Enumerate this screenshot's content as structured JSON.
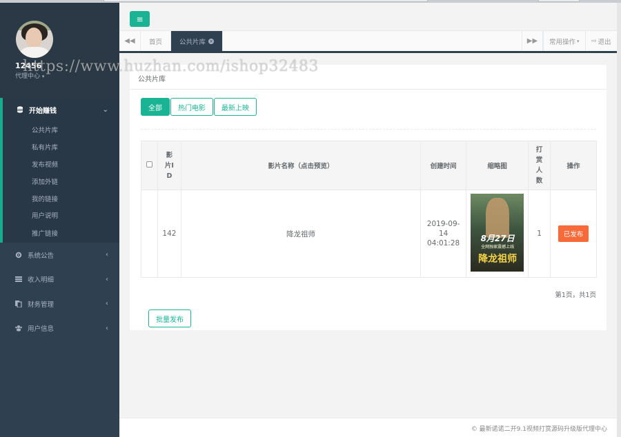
{
  "sidebar": {
    "username": "12456",
    "role": "代理中心",
    "active_group": {
      "label": "开始赚钱",
      "items": [
        {
          "label": "公共片库"
        },
        {
          "label": "私有片库"
        },
        {
          "label": "发布视频"
        },
        {
          "label": "添加外链"
        },
        {
          "label": "我的链接"
        },
        {
          "label": "用户说明"
        },
        {
          "label": "推广链接"
        }
      ]
    },
    "groups": [
      {
        "label": "系统公告",
        "icon": "gear-icon"
      },
      {
        "label": "收入明细",
        "icon": "list-icon"
      },
      {
        "label": "财务管理",
        "icon": "copy-icon"
      },
      {
        "label": "用户信息",
        "icon": "users-icon"
      }
    ]
  },
  "tabs": {
    "home": "首页",
    "current": "公共片库",
    "common_ops": "常用操作",
    "logout": "退出"
  },
  "panel": {
    "title": "公共片库",
    "filters": [
      "全部",
      "热门电影",
      "最新上映"
    ],
    "columns": {
      "id": "影片ID",
      "name": "影片名称（点击预览）",
      "created": "创建时间",
      "thumb": "缩略图",
      "tips": "打赏人数",
      "action": "操作"
    },
    "rows": [
      {
        "id": "142",
        "name": "降龙祖师",
        "created": "2019-09-14 04:01:28",
        "poster_line1": "8月27日",
        "poster_line2": "全网独家震撼上线",
        "poster_title": "降龙祖师",
        "tips": "1",
        "status": "已发布"
      }
    ],
    "pager": "第1页，共1页",
    "batch_button": "批量发布"
  },
  "footer": "© 最新诺诺二开9.1视频打赏源码升级版代理中心",
  "watermark": "https://www.huzhan.com/ishop32483",
  "colors": {
    "accent": "#1ab394",
    "sidebar_bg": "#2f4050",
    "status_btn": "#f96a3a"
  }
}
